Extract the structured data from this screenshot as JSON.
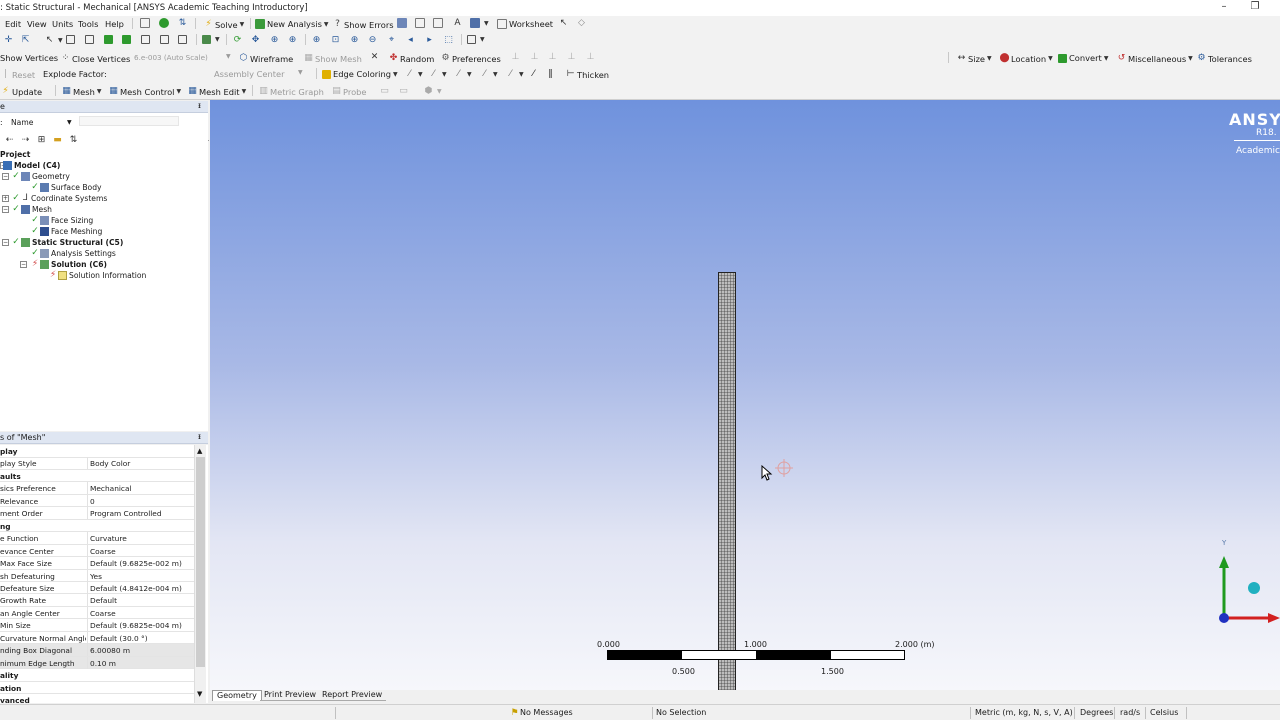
{
  "window": {
    "title": ": Static Structural - Mechanical [ANSYS Academic Teaching Introductory]",
    "minimize": "–",
    "restore": "❐"
  },
  "menu": {
    "items": [
      "Edit",
      "View",
      "Units",
      "Tools",
      "Help"
    ],
    "solve": "Solve",
    "new_analysis": "New Analysis",
    "show_errors": "Show Errors",
    "worksheet": "Worksheet"
  },
  "toolbar3": {
    "show_vertices": "Show Vertices",
    "close_vertices": "Close Vertices",
    "auto_scale": "6.e-003 (Auto Scale)",
    "wireframe": "Wireframe",
    "show_mesh": "Show Mesh",
    "random": "Random",
    "preferences": "Preferences",
    "size": "Size",
    "location": "Location",
    "convert": "Convert",
    "miscellaneous": "Miscellaneous",
    "tolerances": "Tolerances"
  },
  "toolbar4": {
    "reset": "Reset",
    "explode_factor": "Explode Factor:",
    "assembly_center": "Assembly Center",
    "edge_coloring": "Edge Coloring",
    "thicken": "Thicken"
  },
  "toolbar5": {
    "update": "Update",
    "mesh": "Mesh",
    "mesh_control": "Mesh Control",
    "mesh_edit": "Mesh Edit",
    "metric_graph": "Metric Graph",
    "probe": "Probe"
  },
  "outline": {
    "header": "e",
    "filter_label": "Name",
    "tree": [
      {
        "label": "Project",
        "bold": true
      },
      {
        "label": "Model (C4)",
        "bold": true
      },
      {
        "label": "Geometry",
        "bold": false
      },
      {
        "label": "Surface Body",
        "bold": false
      },
      {
        "label": "Coordinate Systems",
        "bold": false
      },
      {
        "label": "Mesh",
        "bold": false
      },
      {
        "label": "Face Sizing",
        "bold": false
      },
      {
        "label": "Face Meshing",
        "bold": false
      },
      {
        "label": "Static Structural (C5)",
        "bold": true
      },
      {
        "label": "Analysis Settings",
        "bold": false
      },
      {
        "label": "Solution (C6)",
        "bold": true
      },
      {
        "label": "Solution Information",
        "bold": false
      }
    ]
  },
  "details": {
    "header": "s of \"Mesh\"",
    "rows": [
      {
        "k": "play",
        "v": "",
        "cat": true
      },
      {
        "k": "play Style",
        "v": "Body Color",
        "cat": false
      },
      {
        "k": "aults",
        "v": "",
        "cat": true
      },
      {
        "k": "sics Preference",
        "v": "Mechanical",
        "cat": false
      },
      {
        "k": "Relevance",
        "v": "0",
        "cat": false
      },
      {
        "k": "ment Order",
        "v": "Program Controlled",
        "cat": false
      },
      {
        "k": "ng",
        "v": "",
        "cat": true
      },
      {
        "k": "e Function",
        "v": "Curvature",
        "cat": false
      },
      {
        "k": "evance Center",
        "v": "Coarse",
        "cat": false
      },
      {
        "k": "Max Face Size",
        "v": "Default (9.6825e-002 m)",
        "cat": false
      },
      {
        "k": "sh Defeaturing",
        "v": "Yes",
        "cat": false
      },
      {
        "k": "Defeature Size",
        "v": "Default (4.8412e-004 m)",
        "cat": false
      },
      {
        "k": "Growth Rate",
        "v": "Default",
        "cat": false
      },
      {
        "k": "an Angle Center",
        "v": "Coarse",
        "cat": false
      },
      {
        "k": "Min Size",
        "v": "Default (9.6825e-004 m)",
        "cat": false
      },
      {
        "k": "Curvature Normal Angle",
        "v": "Default (30.0 °)",
        "cat": false
      },
      {
        "k": "nding Box Diagonal",
        "v": "6.00080 m",
        "cat": false,
        "hl": true
      },
      {
        "k": "nimum Edge Length",
        "v": "0.10 m",
        "cat": false,
        "hl": true
      },
      {
        "k": "ality",
        "v": "",
        "cat": true
      },
      {
        "k": "ation",
        "v": "",
        "cat": true
      },
      {
        "k": "vanced",
        "v": "",
        "cat": true
      }
    ]
  },
  "viewport": {
    "logo_main": "ANSYS",
    "logo_release": "R18.",
    "logo_sub": "Academic",
    "triad_y": "Y",
    "scale_labels": [
      "0.000",
      "1.000",
      "2.000 (m)",
      "0.500",
      "1.500"
    ]
  },
  "tabs": [
    "Geometry",
    "Print Preview",
    "Report Preview"
  ],
  "status": {
    "messages": "No Messages",
    "selection": "No Selection",
    "units": "Metric (m, kg, N, s, V, A)",
    "degrees": "Degrees",
    "rads": "rad/s",
    "celsius": "Celsius"
  },
  "colors": {
    "accent_green": "#2e9a2e",
    "accent_blue": "#2a5a9a",
    "solve_yellow": "#f0c000",
    "viewport_top": "#6f92dd"
  }
}
